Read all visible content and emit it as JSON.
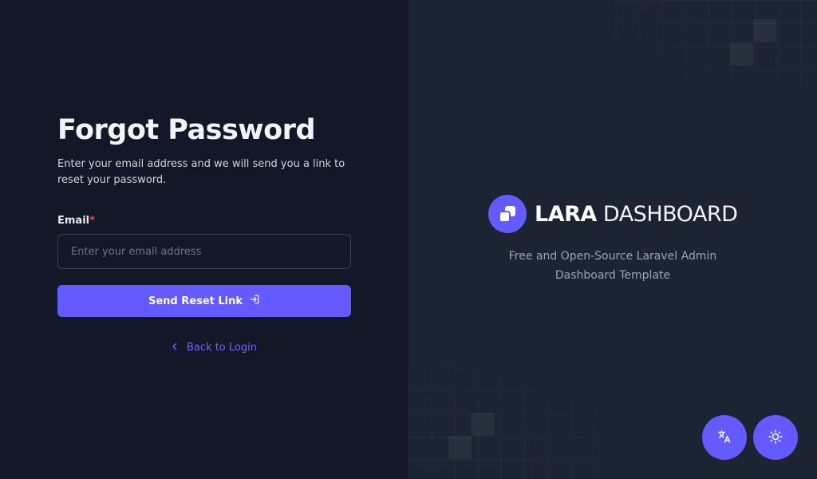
{
  "form": {
    "title": "Forgot Password",
    "subtitle": "Enter your email address and we will send you a link to reset your password.",
    "email_label": "Email",
    "email_required_mark": "*",
    "email_placeholder": "Enter your email address",
    "email_value": "",
    "submit_label": "Send Reset Link",
    "back_label": "Back to Login"
  },
  "brand": {
    "name_bold": "LARA",
    "name_light": "DASHBOARD",
    "tagline": "Free and Open-Source Laravel Admin Dashboard Template"
  },
  "floating_actions": {
    "translate_icon": "translate-icon",
    "theme_icon": "sun-icon"
  },
  "colors": {
    "accent": "#635bff",
    "left_bg": "#121827",
    "right_bg": "#1c2332",
    "required": "#ef4444"
  }
}
